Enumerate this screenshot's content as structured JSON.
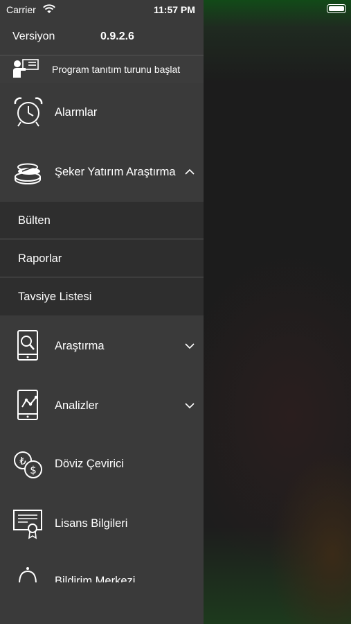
{
  "status_bar": {
    "carrier": "Carrier",
    "time": "11:57 PM"
  },
  "drawer": {
    "version_label": "Versiyon",
    "version_value": "0.9.2.6",
    "tour_label": "Program tanıtım turunu başlat",
    "items": [
      {
        "label": "Alarmlar",
        "icon": "alarm-clock-icon"
      },
      {
        "label": "Şeker Yatırım Araştırma",
        "icon": "coins-icon",
        "expanded": true
      },
      {
        "label": "Araştırma",
        "icon": "tablet-search-icon",
        "expanded": false
      },
      {
        "label": "Analizler",
        "icon": "tablet-chart-icon",
        "expanded": false
      },
      {
        "label": "Döviz Çevirici",
        "icon": "currency-exchange-icon"
      },
      {
        "label": "Lisans Bilgileri",
        "icon": "certificate-icon"
      },
      {
        "label": "Bildirim Merkezi",
        "icon": "bell-icon"
      }
    ],
    "subitems": [
      {
        "label": "Bülten"
      },
      {
        "label": "Raporlar"
      },
      {
        "label": "Tavsiye Listesi"
      }
    ]
  },
  "colors": {
    "drawer_bg": "#3a3a3a",
    "submenu_bg": "#2e2e2e",
    "text": "#ffffff"
  }
}
